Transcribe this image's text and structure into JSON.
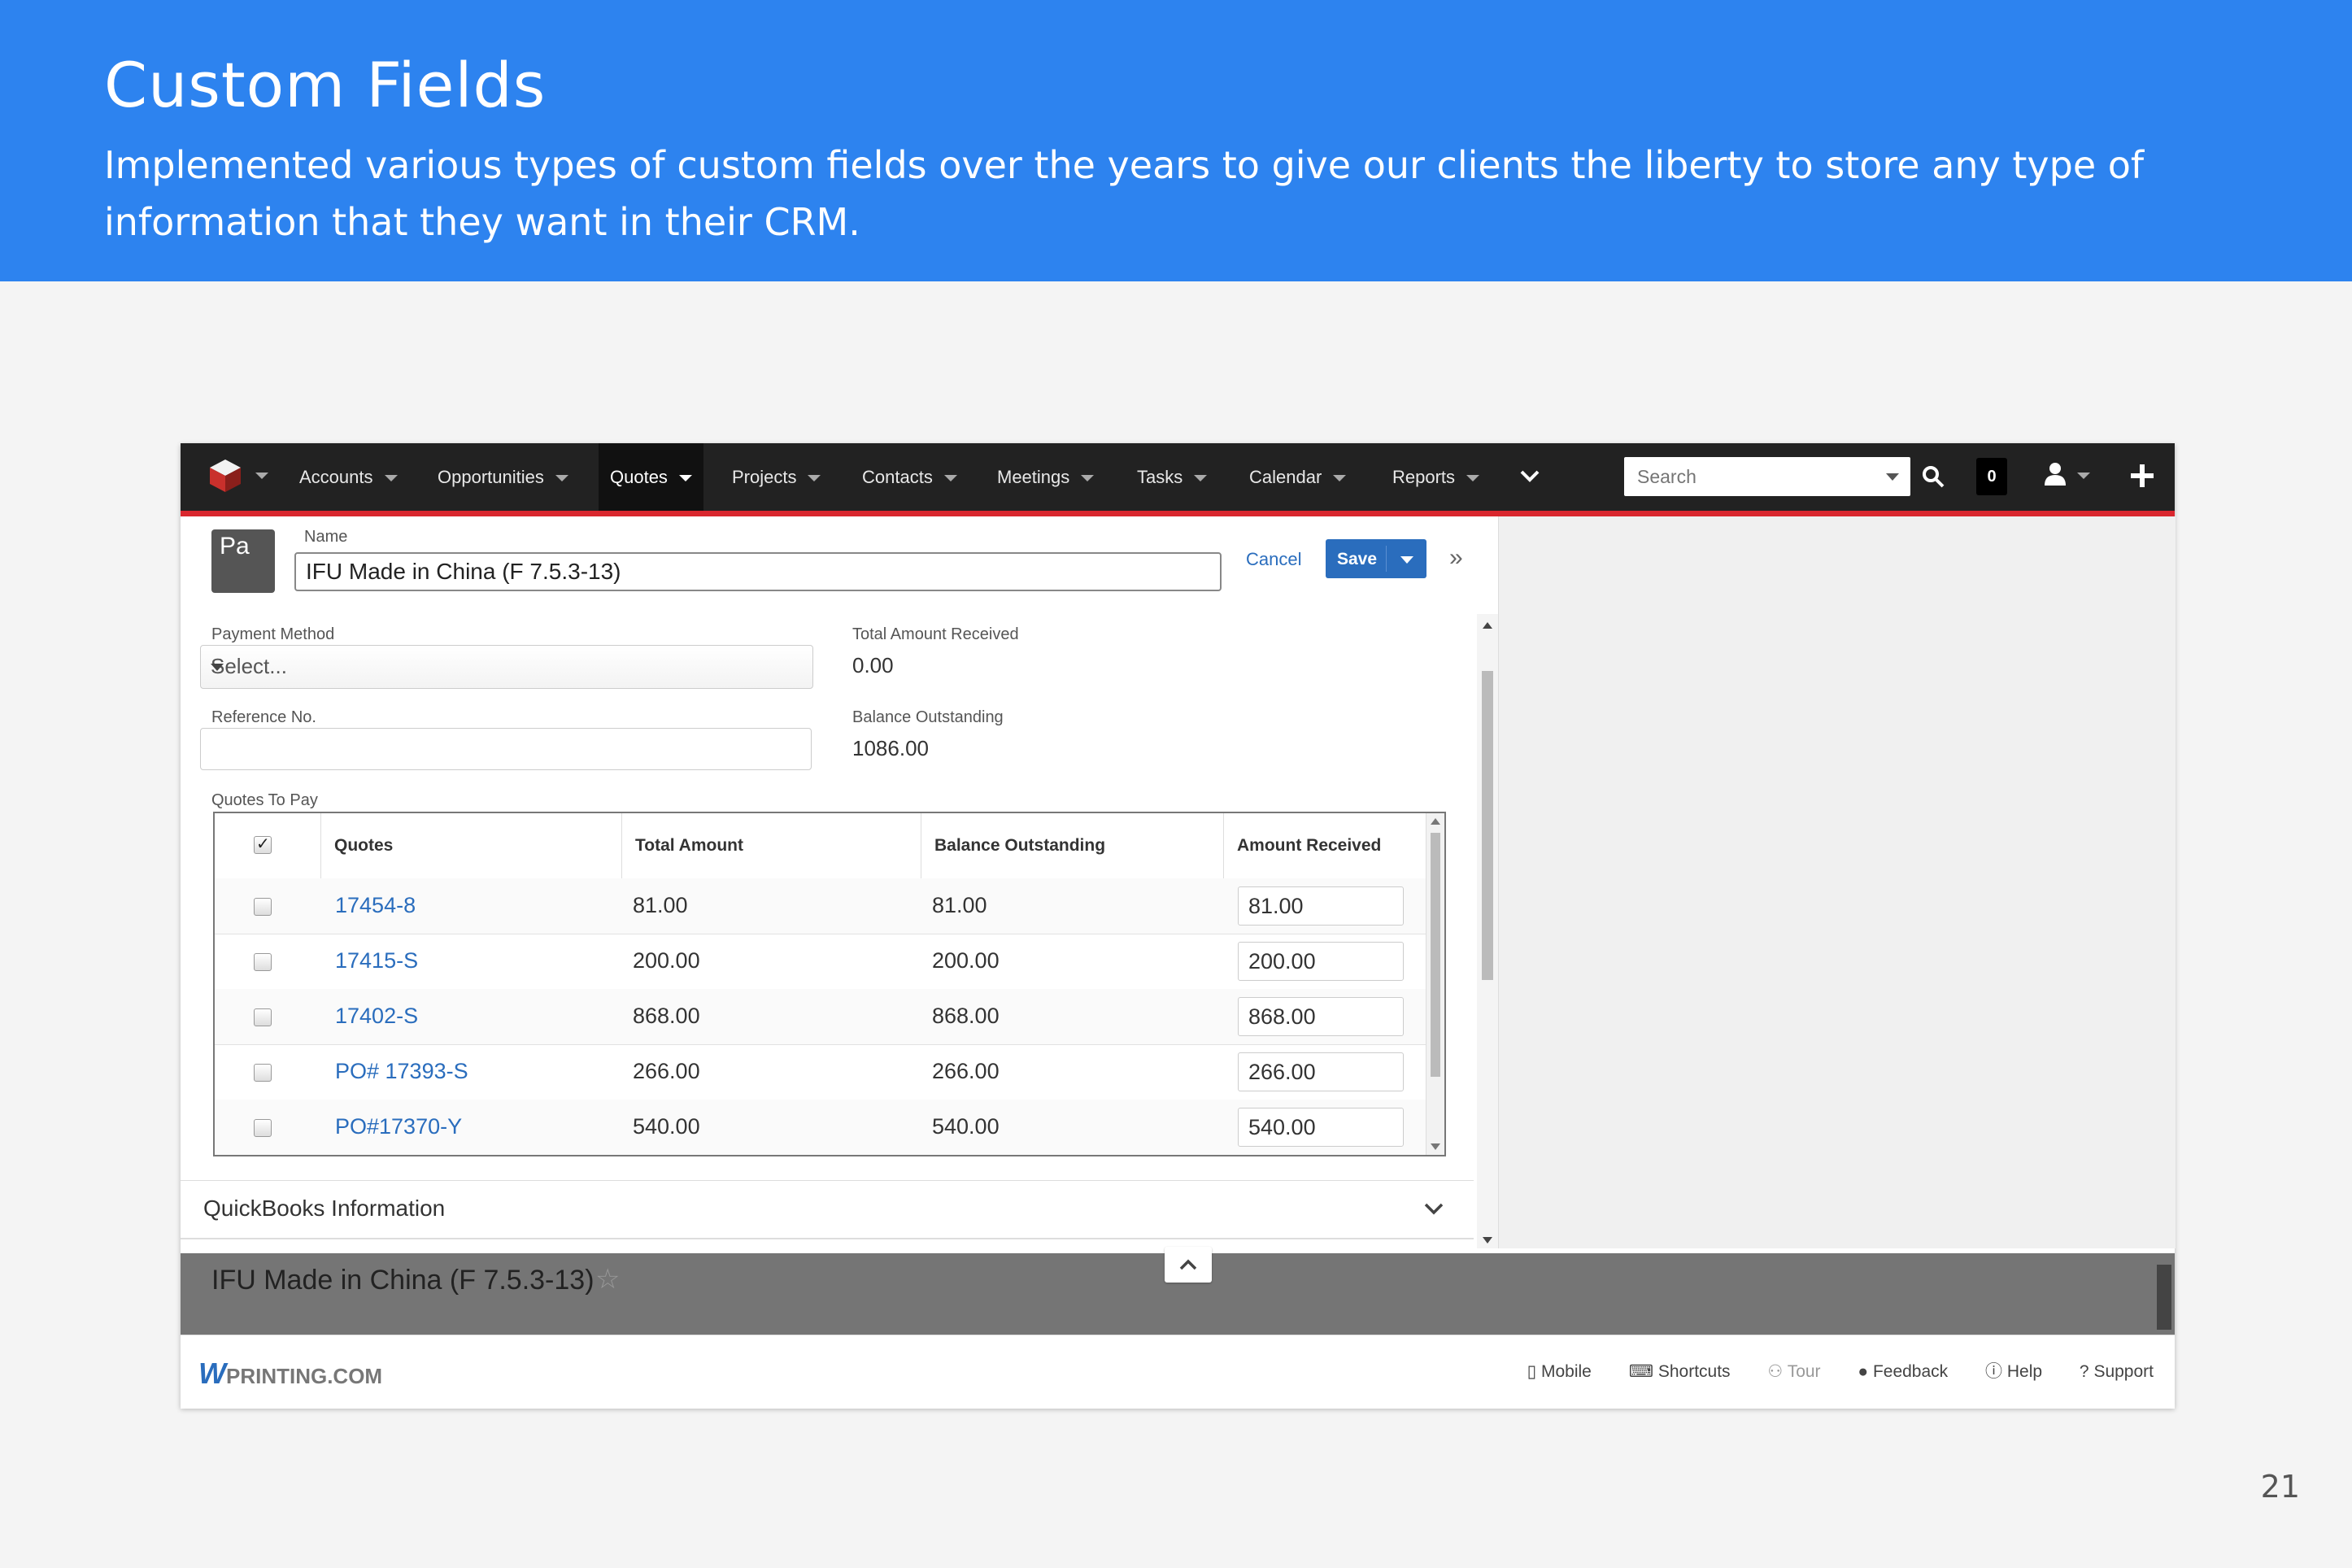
{
  "banner": {
    "title": "Custom Fields",
    "subtitle": "Implemented various types of custom fields over the years to give our clients the liberty to store any type of information that they want in their CRM."
  },
  "page_number": "21",
  "nav": {
    "items": [
      {
        "label": "Accounts"
      },
      {
        "label": "Opportunities"
      },
      {
        "label": "Quotes",
        "active": true
      },
      {
        "label": "Projects"
      },
      {
        "label": "Contacts"
      },
      {
        "label": "Meetings"
      },
      {
        "label": "Tasks"
      },
      {
        "label": "Calendar"
      },
      {
        "label": "Reports"
      }
    ],
    "search_placeholder": "Search",
    "notification_count": "0",
    "accent_color": "#d9272e"
  },
  "record": {
    "avatar_text": "Pa",
    "name_label": "Name",
    "name_value": "IFU Made in China (F 7.5.3-13)",
    "cancel_label": "Cancel",
    "save_label": "Save"
  },
  "form": {
    "payment_method_label": "Payment Method",
    "payment_method_value": "Select...",
    "reference_label": "Reference No.",
    "reference_value": "",
    "total_received_label": "Total Amount Received",
    "total_received_value": "0.00",
    "balance_label": "Balance Outstanding",
    "balance_value": "1086.00",
    "quotes_to_pay_label": "Quotes To Pay"
  },
  "table": {
    "headers": [
      "Quotes",
      "Total Amount",
      "Balance Outstanding",
      "Amount Received"
    ],
    "rows": [
      {
        "quote": "17454-8",
        "total": "81.00",
        "balance": "81.00",
        "received": "81.00"
      },
      {
        "quote": "17415-S",
        "total": "200.00",
        "balance": "200.00",
        "received": "200.00"
      },
      {
        "quote": "17402-S",
        "total": "868.00",
        "balance": "868.00",
        "received": "868.00"
      },
      {
        "quote": "PO# 17393-S",
        "total": "266.00",
        "balance": "266.00",
        "received": "266.00"
      },
      {
        "quote": "PO#17370-Y",
        "total": "540.00",
        "balance": "540.00",
        "received": "540.00"
      }
    ]
  },
  "quickbooks_label": "QuickBooks Information",
  "footer_record_title": "IFU Made in China (F 7.5.3-13)",
  "footer": {
    "brand": "PRINTING.COM",
    "links": [
      "Mobile",
      "Shortcuts",
      "Tour",
      "Feedback",
      "Help",
      "Support"
    ]
  }
}
